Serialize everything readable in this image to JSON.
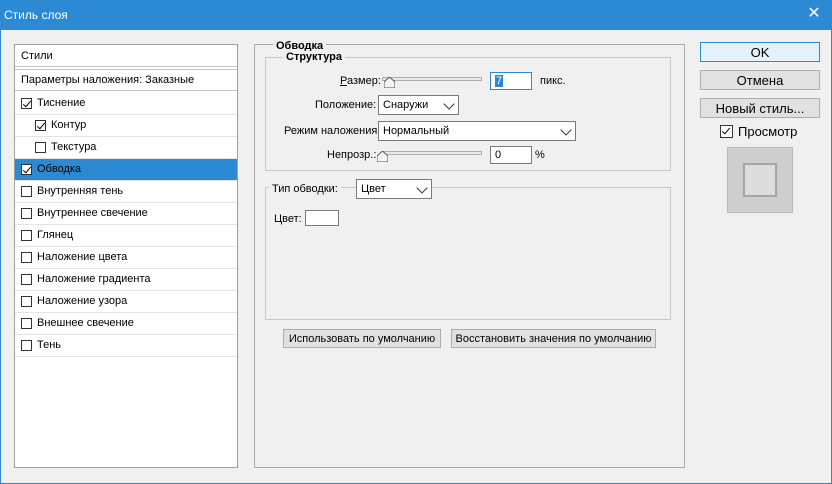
{
  "window": {
    "title": "Стиль слоя",
    "close_symbol": "✕"
  },
  "stylelist": {
    "header": "Стили",
    "blend": "Параметры наложения: Заказные",
    "items": [
      {
        "label": "Тиснение",
        "checked": true,
        "sub": false,
        "selected": false
      },
      {
        "label": "Контур",
        "checked": true,
        "sub": true,
        "selected": false
      },
      {
        "label": "Текстура",
        "checked": false,
        "sub": true,
        "selected": false
      },
      {
        "label": "Обводка",
        "checked": true,
        "sub": false,
        "selected": true
      },
      {
        "label": "Внутренняя тень",
        "checked": false,
        "sub": false,
        "selected": false
      },
      {
        "label": "Внутреннее свечение",
        "checked": false,
        "sub": false,
        "selected": false
      },
      {
        "label": "Глянец",
        "checked": false,
        "sub": false,
        "selected": false
      },
      {
        "label": "Наложение цвета",
        "checked": false,
        "sub": false,
        "selected": false
      },
      {
        "label": "Наложение градиента",
        "checked": false,
        "sub": false,
        "selected": false
      },
      {
        "label": "Наложение узора",
        "checked": false,
        "sub": false,
        "selected": false
      },
      {
        "label": "Внешнее свечение",
        "checked": false,
        "sub": false,
        "selected": false
      },
      {
        "label": "Тень",
        "checked": false,
        "sub": false,
        "selected": false
      }
    ]
  },
  "stroke": {
    "group_title": "Обводка",
    "structure_title": "Структура",
    "size_label": "Размер:",
    "size_value": "7",
    "size_unit": "пикс.",
    "position_label": "Положение:",
    "position_value": "Снаружи",
    "blend_label": "Режим наложения:",
    "blend_value": "Нормальный",
    "opacity_label": "Непрозр.:",
    "opacity_value": "0",
    "opacity_unit": "%",
    "fill_type_label": "Тип обводки:",
    "fill_type_value": "Цвет",
    "color_label": "Цвет:",
    "color_value": "#ffffff",
    "btn_default": "Использовать по умолчанию",
    "btn_reset": "Восстановить значения по умолчанию"
  },
  "right": {
    "ok": "OK",
    "cancel": "Отмена",
    "new_style": "Новый стиль...",
    "preview_label": "Просмотр",
    "preview_checked": true
  },
  "colors": {
    "accent": "#2b8ad3",
    "titlebar": "#2b8ad3"
  },
  "icons": {
    "close": "close-icon",
    "dropdown": "chevron-down-icon",
    "slider_thumb": "slider-thumb-icon"
  }
}
